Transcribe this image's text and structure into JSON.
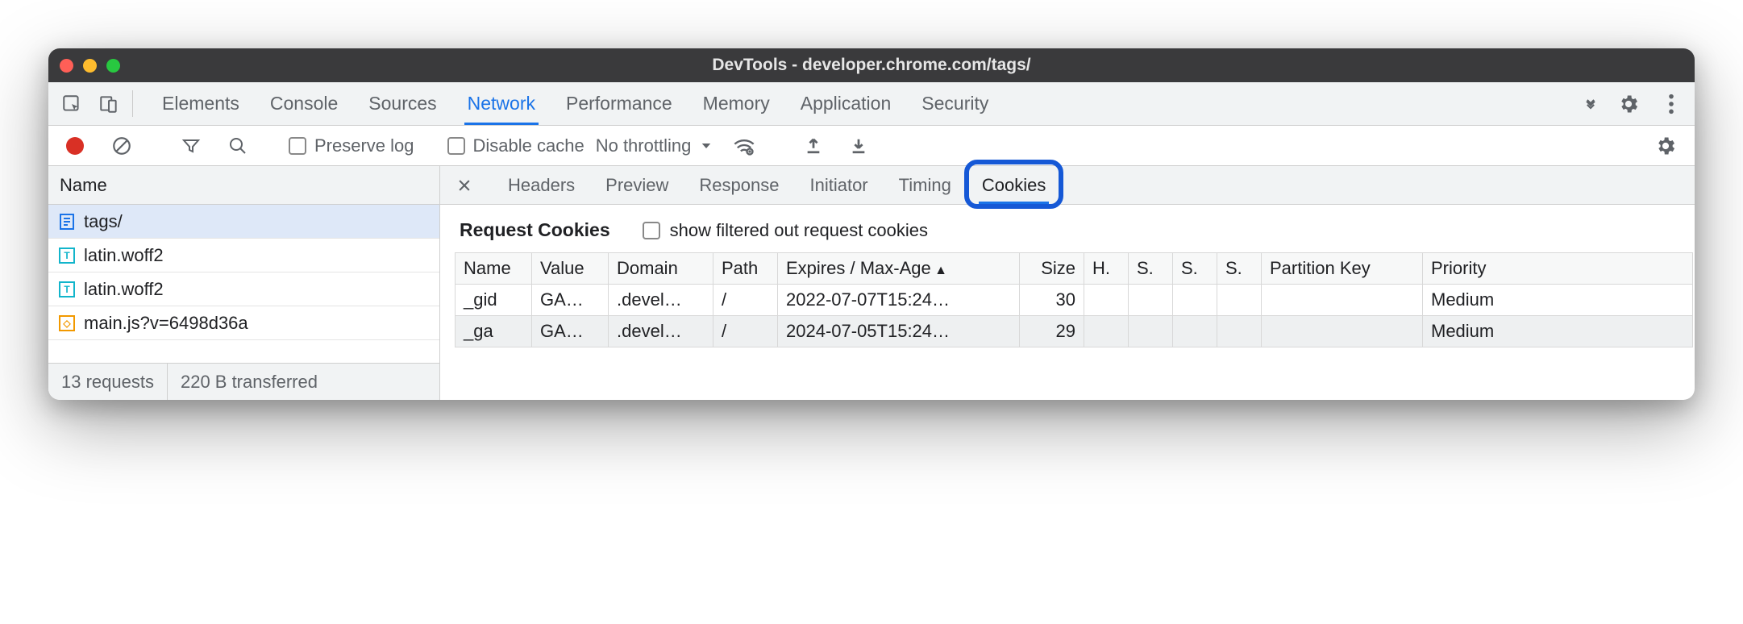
{
  "window_title": "DevTools - developer.chrome.com/tags/",
  "top_tabs": [
    "Elements",
    "Console",
    "Sources",
    "Network",
    "Performance",
    "Memory",
    "Application",
    "Security"
  ],
  "top_active": "Network",
  "toolbar": {
    "preserve_log": "Preserve log",
    "disable_cache": "Disable cache",
    "throttling": "No throttling"
  },
  "reqlist": {
    "header": "Name",
    "items": [
      {
        "name": "tags/",
        "type": "doc",
        "selected": true
      },
      {
        "name": "latin.woff2",
        "type": "font"
      },
      {
        "name": "latin.woff2",
        "type": "font"
      },
      {
        "name": "main.js?v=6498d36a",
        "type": "js"
      }
    ],
    "status_requests": "13 requests",
    "status_transferred": "220 B transferred"
  },
  "detail_tabs": [
    "Headers",
    "Preview",
    "Response",
    "Initiator",
    "Timing",
    "Cookies"
  ],
  "detail_active": "Cookies",
  "section_title": "Request Cookies",
  "filter_label": "show filtered out request cookies",
  "cookie_headers": [
    "Name",
    "Value",
    "Domain",
    "Path",
    "Expires / Max-Age",
    "Size",
    "H.",
    "S.",
    "S.",
    "S.",
    "Partition Key",
    "Priority"
  ],
  "sort_col": "Expires / Max-Age",
  "cookies": [
    {
      "name": "_gid",
      "value": "GA…",
      "domain": ".devel…",
      "path": "/",
      "expires": "2022-07-07T15:24…",
      "size": "30",
      "h": "",
      "s1": "",
      "s2": "",
      "s3": "",
      "pk": "",
      "priority": "Medium"
    },
    {
      "name": "_ga",
      "value": "GA…",
      "domain": ".devel…",
      "path": "/",
      "expires": "2024-07-05T15:24…",
      "size": "29",
      "h": "",
      "s1": "",
      "s2": "",
      "s3": "",
      "pk": "",
      "priority": "Medium"
    }
  ]
}
